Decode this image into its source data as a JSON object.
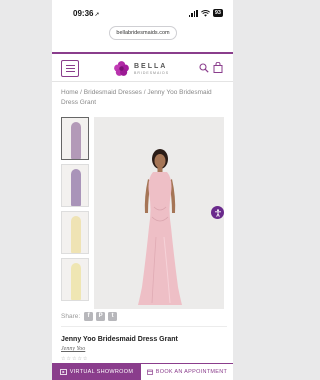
{
  "status_bar": {
    "time": "09:36",
    "battery": "93"
  },
  "browser": {
    "url": "bellabridesmaids.com"
  },
  "header": {
    "logo_text": "BELLA",
    "logo_sub": "BRIDESMAIDS"
  },
  "breadcrumb": "Home / Bridesmaid Dresses / Jenny Yoo Bridesmaid Dress Grant",
  "thumbnails": [
    {
      "color": "#b39ab8"
    },
    {
      "color": "#a994b9"
    },
    {
      "color": "#efe3b4"
    },
    {
      "color": "#efe6b3"
    }
  ],
  "main_image": {
    "dress_color": "#eebfc6"
  },
  "share": {
    "label": "Share:",
    "icons": [
      "facebook-icon",
      "pinterest-icon",
      "twitter-icon"
    ]
  },
  "product": {
    "title": "Jenny Yoo Bridesmaid Dress Grant",
    "brand": "Jenny Yoo"
  },
  "bottom_bar": {
    "showroom_label": "VIRTUAL SHOWROOM",
    "appointment_label": "BOOK AN APPOINTMENT"
  },
  "colors": {
    "brand": "#8a3d8c"
  }
}
